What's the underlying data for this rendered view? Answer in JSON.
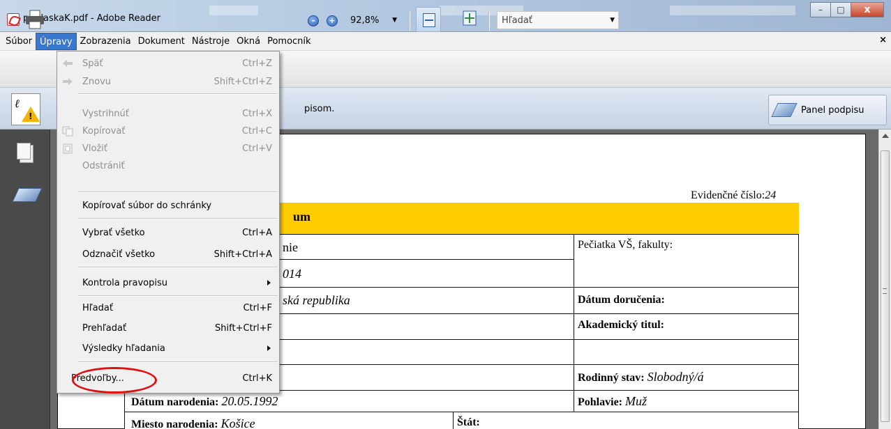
{
  "window": {
    "title": "prihlaskaK.pdf - Adobe Reader",
    "controls": {
      "minimize": "–",
      "maximize": "□",
      "close": "x"
    }
  },
  "menubar": {
    "items": [
      "Súbor",
      "Úpravy",
      "Zobrazenia",
      "Dokument",
      "Nástroje",
      "Okná",
      "Pomocník"
    ],
    "active": "Úpravy",
    "close_doc": "×"
  },
  "toolbar": {
    "zoom_value": "92,8%",
    "search_placeholder": "Hľadať"
  },
  "signature_bar": {
    "message_fragment": "pisom.",
    "panel_button": "Panel podpisu"
  },
  "edit_menu": {
    "items": [
      {
        "label": "Späť",
        "shortcut": "Ctrl+Z",
        "disabled": true,
        "icon": "undo-icon"
      },
      {
        "label": "Znovu",
        "shortcut": "Shift+Ctrl+Z",
        "disabled": true,
        "icon": "redo-icon"
      },
      {
        "label": "Vystrihnúť",
        "shortcut": "Ctrl+X",
        "disabled": true
      },
      {
        "label": "Kopírovať",
        "shortcut": "Ctrl+C",
        "disabled": true,
        "icon": "copy-icon"
      },
      {
        "label": "Vložiť",
        "shortcut": "Ctrl+V",
        "disabled": true,
        "icon": "paste-icon"
      },
      {
        "label": "Odstrániť",
        "shortcut": "",
        "disabled": true
      },
      {
        "label": "Kopírovať súbor do schránky",
        "shortcut": "",
        "disabled": false
      },
      {
        "label": "Vybrať všetko",
        "shortcut": "Ctrl+A",
        "disabled": false
      },
      {
        "label": "Odznačiť všetko",
        "shortcut": "Shift+Ctrl+A",
        "disabled": false
      },
      {
        "label": "Kontrola pravopisu",
        "shortcut": "",
        "disabled": false,
        "submenu": true
      },
      {
        "label": "Hľadať",
        "shortcut": "Ctrl+F",
        "disabled": false
      },
      {
        "label": "Prehľadať",
        "shortcut": "Shift+Ctrl+F",
        "disabled": false
      },
      {
        "label": "Výsledky hľadania",
        "shortcut": "",
        "disabled": false,
        "submenu": true
      },
      {
        "label": "Predvoľby...",
        "shortcut": "Ctrl+K",
        "disabled": false,
        "highlighted": true
      }
    ]
  },
  "document": {
    "evidence_label": "Evidenčné číslo:",
    "evidence_value": "24",
    "header_fragment": "um",
    "rows": {
      "r1_left": "nie",
      "stamp_label": "Pečiatka VŠ, fakulty:",
      "r2_left": "014",
      "r3_left": "ská republika",
      "delivery_label": "Dátum doručenia:",
      "title_label": "Akademický titul:",
      "marital_label": "Rodinný stav:",
      "marital_value": "Slobodný/á",
      "birthdate_label": "Dátum narodenia:",
      "birthdate_value": "20.05.1992",
      "sex_label": "Pohlavie:",
      "sex_value": "Muž",
      "birthplace_label": "Miesto narodenia:",
      "birthplace_value": "Košice",
      "state_label": "Štát:"
    }
  },
  "colors": {
    "menu_highlight": "#3a78cf",
    "form_header": "#ffcc00",
    "annotation_circle": "#e01010"
  }
}
